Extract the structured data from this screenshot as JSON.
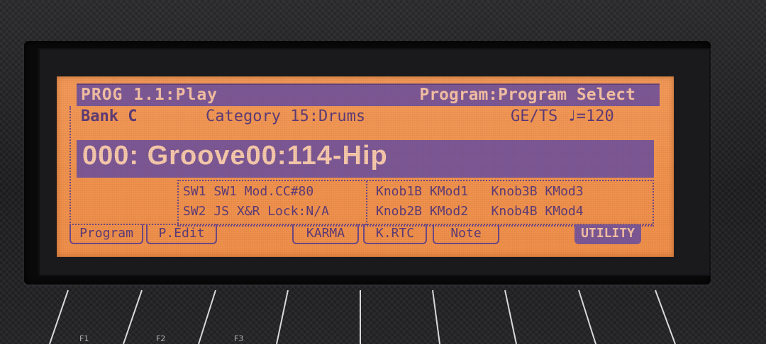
{
  "header": {
    "mode": "PROG 1.1:Play",
    "page": "Program:Program Select"
  },
  "info": {
    "bank": "Bank C",
    "category": "Category 15:Drums",
    "tempo": "GE/TS ♩=120"
  },
  "program": {
    "name": "000: Groove00:114-Hip"
  },
  "assign": {
    "sw_line1": "SW1 SW1 Mod.CC#80",
    "sw_line2": "SW2 JS X&R Lock:N/A",
    "knob_line1": "Knob1B KMod1   Knob3B KMod3",
    "knob_line2": "Knob2B KMod2   Knob4B KMod4"
  },
  "tabs": [
    {
      "label": "Program"
    },
    {
      "label": "P.Edit"
    },
    {
      "label": "KARMA"
    },
    {
      "label": "K.RTC"
    },
    {
      "label": "Note"
    },
    {
      "label": "UTILITY"
    }
  ],
  "function_keys": [
    {
      "label": "F1"
    },
    {
      "label": "F2"
    },
    {
      "label": "F3"
    }
  ],
  "colors": {
    "lcd_background": "#f0934f",
    "lcd_ink": "#5a3a78",
    "highlight_bar": "#7a5796",
    "highlight_text": "#f3c0a4"
  }
}
